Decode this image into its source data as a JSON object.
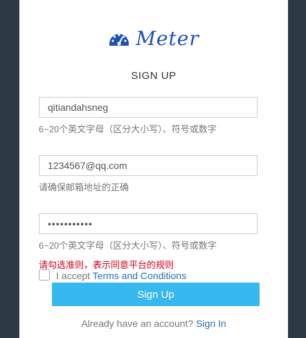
{
  "brand": {
    "name": "Meter",
    "logo_icon": "speedometer-icon",
    "color": "#1f4fb3"
  },
  "form": {
    "heading": "SIGN UP",
    "username": {
      "value": "qitiandahsneg",
      "hint": "6~20个英文字母（区分大小写）、符号或数字"
    },
    "email": {
      "value": "1234567@qq.com",
      "hint": "请确保邮箱地址的正确"
    },
    "password": {
      "value": "•••••••••••",
      "hint": "6~20个英文字母（区分大小写）、符号或数字"
    },
    "terms_error": "请勾选准则，表示同意平台的规则",
    "accept_prefix": "I accept",
    "terms_link": "Terms and Conditions",
    "submit_label": "Sign Up",
    "have_account": "Already have an account?",
    "signin_link": "Sign In"
  },
  "colors": {
    "background": "#2c3a44",
    "button": "#37b8ef",
    "link": "#2a6fb0",
    "error": "#d0021b"
  }
}
